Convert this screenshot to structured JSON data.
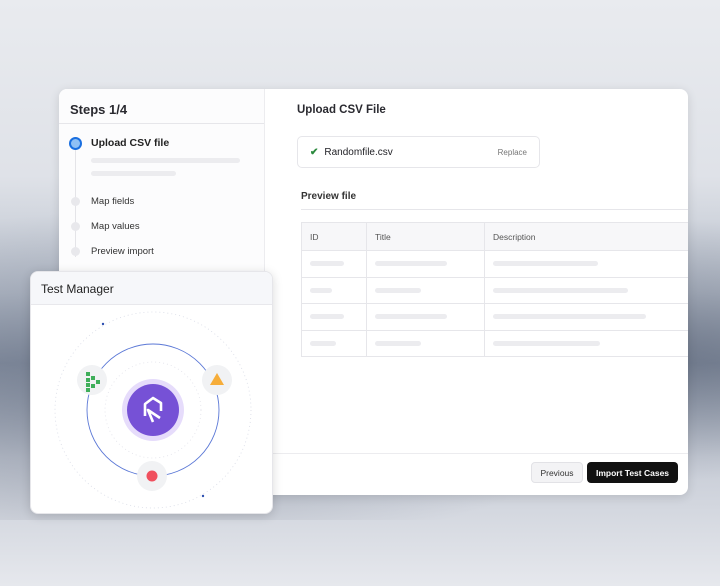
{
  "steps": {
    "title": "Steps 1/4",
    "items": [
      {
        "label": "Upload CSV file",
        "active": true
      },
      {
        "label": "Map fields"
      },
      {
        "label": "Map values"
      },
      {
        "label": "Preview import"
      }
    ]
  },
  "main": {
    "title": "Upload CSV File",
    "file": {
      "name": "Randomfile.csv",
      "replace_label": "Replace",
      "status_icon": "check-icon"
    },
    "preview_title": "Preview file",
    "columns": [
      "ID",
      "Title",
      "Description"
    ]
  },
  "footer": {
    "previous_label": "Previous",
    "import_label": "Import Test Cases"
  },
  "test_manager": {
    "title": "Test Manager",
    "brand_color": "#7651d6"
  }
}
